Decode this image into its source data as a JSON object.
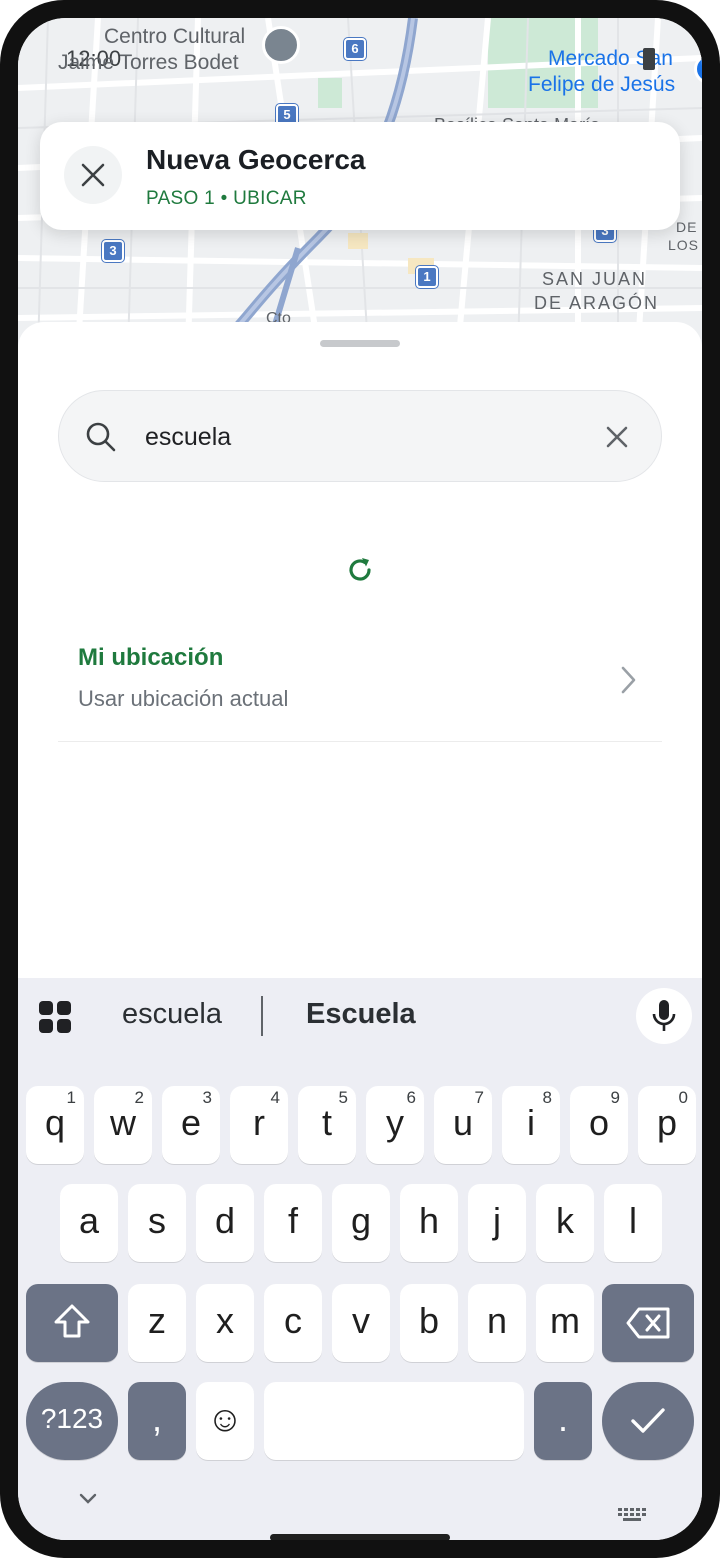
{
  "status_bar": {
    "time": "12:00"
  },
  "map": {
    "labels": {
      "centro_line1": "Centro Cultural",
      "centro_line2": "Jaime Torres Bodet",
      "mercado_line1": "Mercado San",
      "mercado_line2": "Felipe de Jesús",
      "basilica": "Basílica Santa María",
      "de_los_1": "DE",
      "de_los_2": "LOS",
      "san_juan_1": "SAN JUAN",
      "san_juan_2": "DE ARAGÓN",
      "cto": "Cto"
    },
    "route_badges": [
      "6",
      "5",
      "3",
      "1",
      "3"
    ]
  },
  "header": {
    "title": "Nueva Geocerca",
    "step": "PASO 1 • UBICAR"
  },
  "search": {
    "value": "escuela",
    "placeholder": ""
  },
  "location_option": {
    "title": "Mi ubicación",
    "subtitle": "Usar ubicación actual"
  },
  "keyboard": {
    "suggestions": [
      "escuela",
      "Escuela"
    ],
    "row1": [
      {
        "key": "q",
        "hint": "1"
      },
      {
        "key": "w",
        "hint": "2"
      },
      {
        "key": "e",
        "hint": "3"
      },
      {
        "key": "r",
        "hint": "4"
      },
      {
        "key": "t",
        "hint": "5"
      },
      {
        "key": "y",
        "hint": "6"
      },
      {
        "key": "u",
        "hint": "7"
      },
      {
        "key": "i",
        "hint": "8"
      },
      {
        "key": "o",
        "hint": "9"
      },
      {
        "key": "p",
        "hint": "0"
      }
    ],
    "row2": [
      "a",
      "s",
      "d",
      "f",
      "g",
      "h",
      "j",
      "k",
      "l"
    ],
    "row3": [
      "z",
      "x",
      "c",
      "v",
      "b",
      "n",
      "m"
    ],
    "symbols_label": "?123",
    "comma": ",",
    "period": ".",
    "emoji": "☺"
  },
  "colors": {
    "accent_green": "#1f7a3e",
    "key_dark": "#6b7386",
    "keyboard_bg": "#edeef4"
  }
}
